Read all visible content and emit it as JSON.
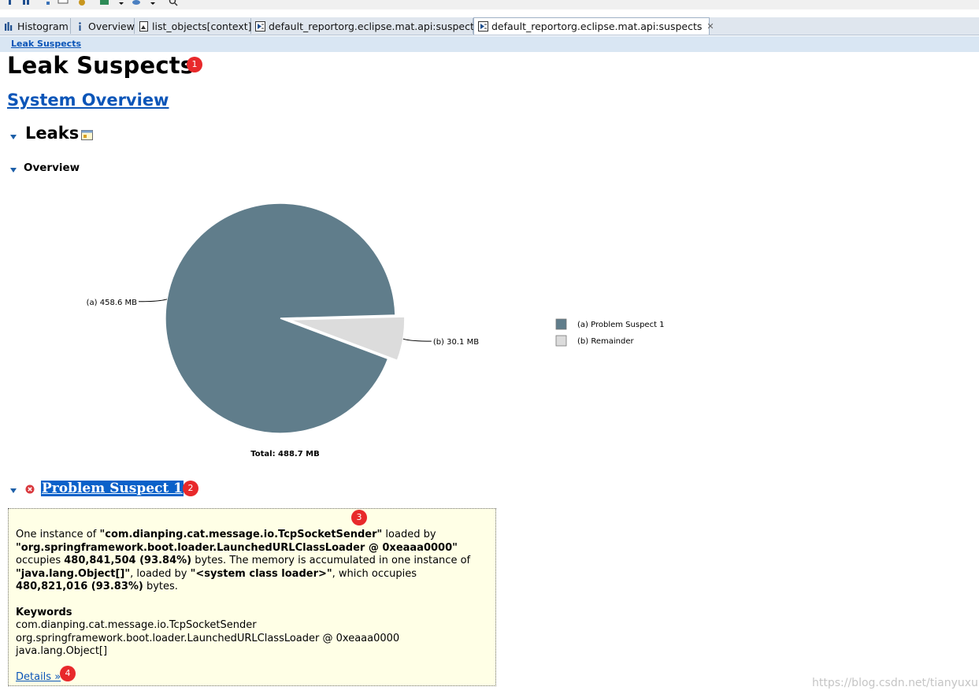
{
  "tabs": [
    {
      "name": "Histogram",
      "detail": ""
    },
    {
      "name": "Overview",
      "detail": ""
    },
    {
      "name": "list_objects",
      "detail": "[context]"
    },
    {
      "name": "default_report",
      "detail": "org.eclipse.mat.api:suspects"
    },
    {
      "name": "default_report",
      "detail": "org.eclipse.mat.api:suspects",
      "active": true
    }
  ],
  "breadcrumb": "Leak Suspects",
  "page_title": "Leak Suspects",
  "system_overview_link": "System Overview",
  "leaks_heading": "Leaks",
  "overview_heading": "Overview",
  "badges": [
    "1",
    "2",
    "3",
    "4"
  ],
  "chart_data": {
    "type": "pie",
    "slices": [
      {
        "label": "(a)",
        "value_label": "458.6 MB",
        "value": 458.6,
        "color": "#607d8b",
        "legend": "Problem Suspect 1"
      },
      {
        "label": "(b)",
        "value_label": "30.1 MB",
        "value": 30.1,
        "color": "#dcdcdc",
        "legend": "Remainder",
        "exploded": true
      }
    ],
    "total_label": "Total: 488.7 MB",
    "legend_placement": "right"
  },
  "problem": {
    "title": "Problem Suspect 1",
    "desc": [
      {
        "t": "One instance of ",
        "b": false
      },
      {
        "t": "\"com.dianping.cat.message.io.TcpSocketSender\"",
        "b": true
      },
      {
        "t": " loaded by ",
        "b": false
      },
      {
        "t": "\"org.springframework.boot.loader.LaunchedURLClassLoader @ 0xeaaa0000\"",
        "b": true
      },
      {
        "t": " occupies ",
        "b": false
      },
      {
        "t": "480,841,504 (93.84%)",
        "b": true
      },
      {
        "t": " bytes. The memory is accumulated in one instance of ",
        "b": false
      },
      {
        "t": "\"java.lang.Object[]\"",
        "b": true
      },
      {
        "t": ", loaded by ",
        "b": false
      },
      {
        "t": "\"<system class loader>\"",
        "b": true
      },
      {
        "t": ", which occupies ",
        "b": false
      },
      {
        "t": "480,821,016 (93.83%)",
        "b": true
      },
      {
        "t": " bytes.",
        "b": false
      }
    ],
    "keywords_label": "Keywords",
    "keywords": [
      "com.dianping.cat.message.io.TcpSocketSender",
      "org.springframework.boot.loader.LaunchedURLClassLoader @ 0xeaaa0000",
      "java.lang.Object[]"
    ],
    "details_link": "Details »"
  },
  "watermark": "https://blog.csdn.net/tianyuxu"
}
